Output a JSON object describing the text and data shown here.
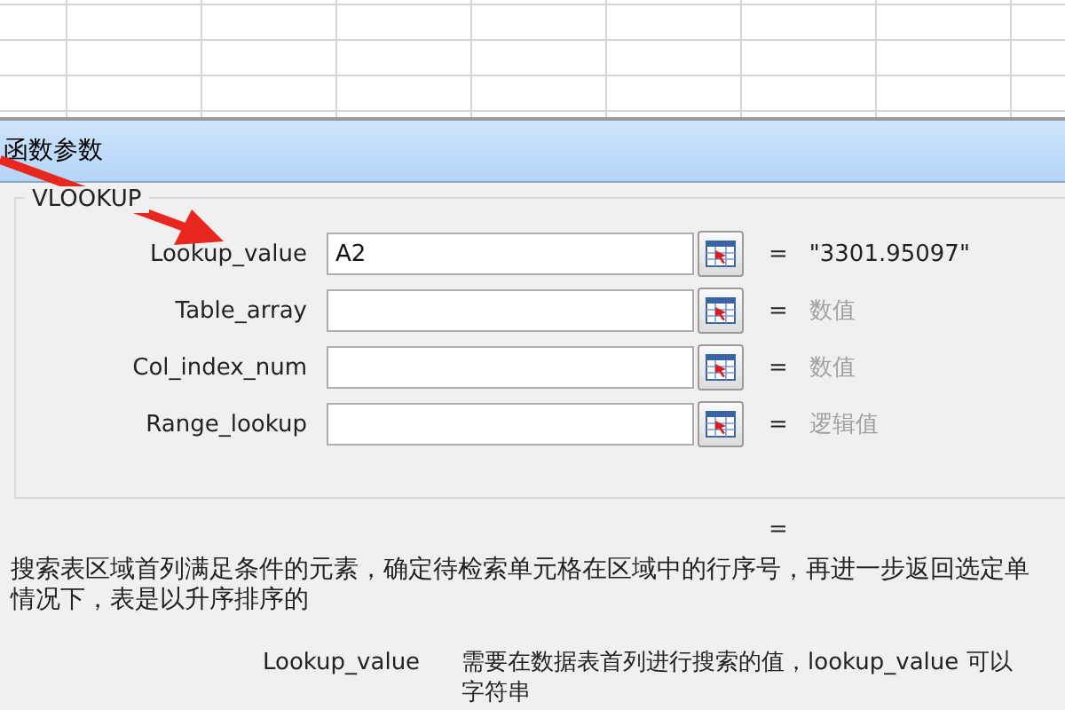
{
  "dialog": {
    "title": "函数参数"
  },
  "function_group": {
    "name": "VLOOKUP",
    "arguments": [
      {
        "label": "Lookup_value",
        "value": "A2",
        "equals": "=",
        "result": "\"3301.95097\"",
        "kind": "value"
      },
      {
        "label": "Table_array",
        "equals": "=",
        "result": "数值",
        "kind": "hint"
      },
      {
        "label": "Col_index_num",
        "equals": "=",
        "result": "数值",
        "kind": "hint"
      },
      {
        "label": "Range_lookup",
        "equals": "=",
        "result": "逻辑值",
        "kind": "hint"
      }
    ]
  },
  "formula_result": {
    "equals": "="
  },
  "description": "搜索表区域首列满足条件的元素，确定待检索单元格在区域中的行序号，再进一步返回选定单情况下，表是以升序排序的",
  "argument_help": {
    "name": "Lookup_value",
    "text": "需要在数据表首列进行搜索的值，lookup_value 可以字符串"
  }
}
